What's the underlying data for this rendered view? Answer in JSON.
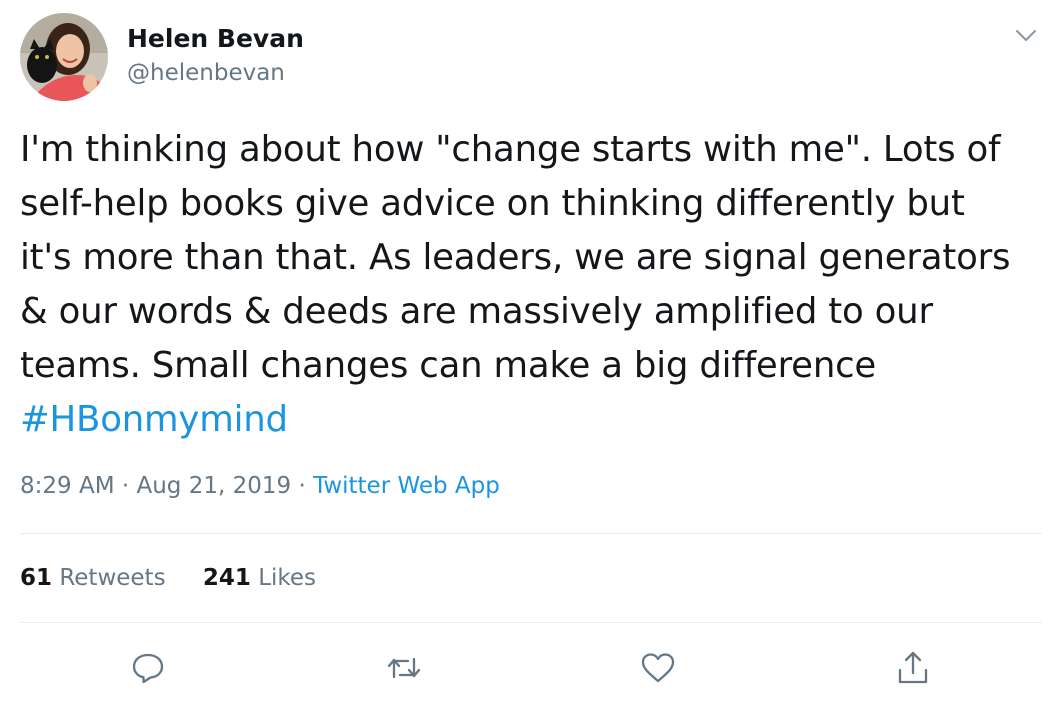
{
  "author": {
    "name": "Helen Bevan",
    "handle": "@helenbevan"
  },
  "tweet": {
    "text": "I'm thinking about how \"change starts with me\". Lots of\nself-help books give advice on thinking differently but\nit's more than that. As leaders, we are signal generators\n& our words & deeds are massively amplified to our\nteams. Small changes can make a big difference\n",
    "hashtag": "#HBonmymind"
  },
  "meta": {
    "time": "8:29 AM",
    "separator1": " · ",
    "date": "Aug 21, 2019",
    "separator2": " · ",
    "source": "Twitter Web App"
  },
  "stats": {
    "retweets_count": "61",
    "retweets_label": "Retweets",
    "likes_count": "241",
    "likes_label": "Likes"
  },
  "icons": {
    "reply": "reply-icon",
    "retweet": "retweet-icon",
    "like": "like-icon",
    "share": "share-icon",
    "caret": "chevron-down-icon"
  },
  "colors": {
    "link": "#1b95e0",
    "secondary_text": "#657786",
    "primary_text": "#14171a",
    "divider": "#e6ecf0"
  }
}
